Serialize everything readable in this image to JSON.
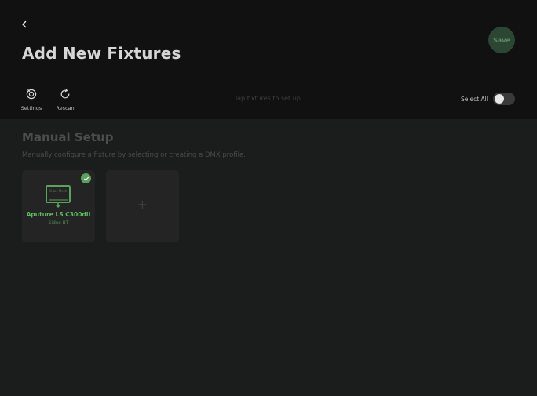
{
  "header": {
    "back_icon": "chevron-left-icon",
    "title": "Add New Fixtures",
    "save_label": "Save",
    "tools": {
      "settings": {
        "label": "Settings",
        "icon": "settings-dial-icon"
      },
      "rescan": {
        "label": "Rescan",
        "icon": "refresh-icon"
      }
    },
    "hint": "Tap fixtures to set up.",
    "select_all_label": "Select All",
    "select_all_on": false
  },
  "manual": {
    "title": "Manual Setup",
    "description": "Manually configure a fixture by selecting or creating a DMX profile.",
    "fixtures": [
      {
        "name": "Aputure LS C300dII",
        "subtitle": "Sidus BT",
        "screen_text": "Sidus Mesh",
        "selected": true,
        "icon": "light-fixture-icon"
      }
    ],
    "add_card_label": "+"
  },
  "colors": {
    "accent": "#5fbb62",
    "header_bg": "#111111",
    "body_bg": "#1b1d1c",
    "card_bg": "#242424",
    "save_bg": "#2b4632"
  }
}
